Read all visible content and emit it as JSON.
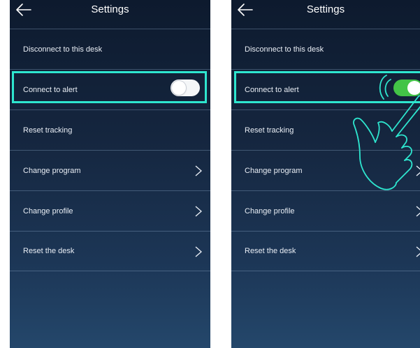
{
  "colors": {
    "highlight": "#2ee6cf",
    "toggle_on": "#43c447",
    "toggle_off": "#f4f6f8",
    "background_top": "#0d1a2e",
    "background_bottom": "#24476b"
  },
  "screens": [
    {
      "header": {
        "title": "Settings",
        "back_icon": "arrow-left-icon"
      },
      "items": [
        {
          "label": "Disconnect to this desk"
        },
        {
          "label": "Connect to alert",
          "toggle": "off"
        },
        {
          "label": "Reset tracking"
        },
        {
          "label": "Change program",
          "icon": "chevron-right-icon"
        },
        {
          "label": "Change profile",
          "icon": "chevron-right-icon"
        },
        {
          "label": "Reset the desk",
          "icon": "chevron-right-icon"
        }
      ]
    },
    {
      "header": {
        "title": "Settings",
        "back_icon": "arrow-left-icon"
      },
      "items": [
        {
          "label": "Disconnect to this desk"
        },
        {
          "label": "Connect to alert",
          "toggle": "on"
        },
        {
          "label": "Reset tracking"
        },
        {
          "label": "Change program",
          "icon": "chevron-right-icon"
        },
        {
          "label": "Change profile",
          "icon": "chevron-right-icon"
        },
        {
          "label": "Reset the desk",
          "icon": "chevron-right-icon"
        }
      ],
      "overlay_icon": "tap-hand-icon"
    }
  ]
}
